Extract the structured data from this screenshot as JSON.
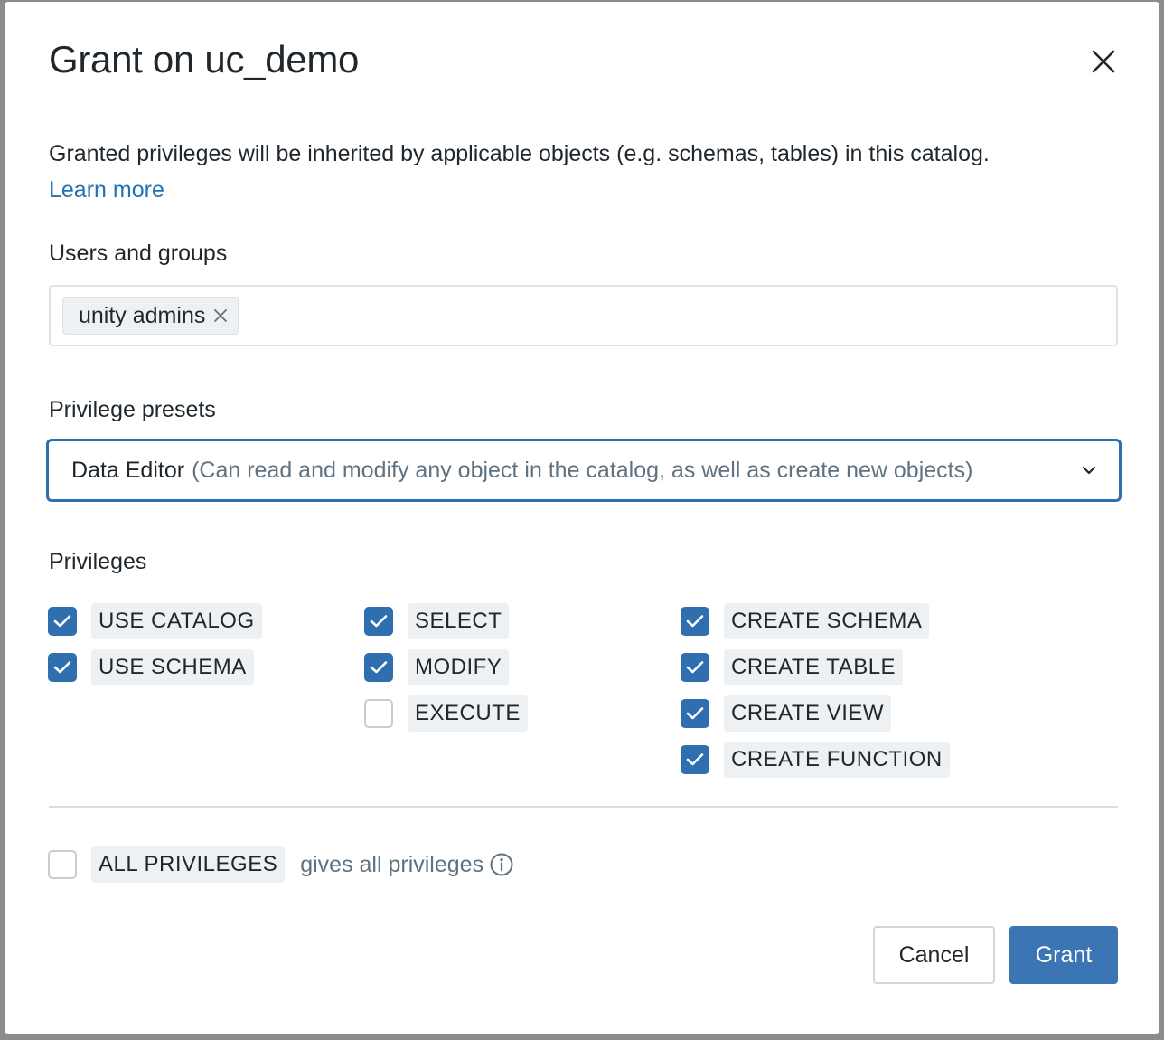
{
  "dialog": {
    "title": "Grant on uc_demo",
    "close_icon": "close-icon",
    "description": "Granted privileges will be inherited by applicable objects (e.g. schemas, tables) in this catalog.",
    "learn_more": "Learn more"
  },
  "users": {
    "label": "Users and groups",
    "tags": [
      {
        "label": "unity admins"
      }
    ]
  },
  "presets": {
    "label": "Privilege presets",
    "selected_name": "Data Editor",
    "selected_desc": "(Can read and modify any object in the catalog, as well as create new objects)"
  },
  "privileges": {
    "label": "Privileges",
    "items": [
      {
        "label": "USE CATALOG",
        "checked": true
      },
      {
        "label": "USE SCHEMA",
        "checked": true
      },
      {
        "label": "SELECT",
        "checked": true
      },
      {
        "label": "MODIFY",
        "checked": true
      },
      {
        "label": "EXECUTE",
        "checked": false
      },
      {
        "label": "CREATE SCHEMA",
        "checked": true
      },
      {
        "label": "CREATE TABLE",
        "checked": true
      },
      {
        "label": "CREATE VIEW",
        "checked": true
      },
      {
        "label": "CREATE FUNCTION",
        "checked": true
      }
    ]
  },
  "all_privileges": {
    "label": "ALL PRIVILEGES",
    "note": "gives all privileges",
    "checked": false
  },
  "buttons": {
    "cancel": "Cancel",
    "grant": "Grant"
  },
  "colors": {
    "accent": "#2f6fb0",
    "link": "#2272b4",
    "primary_button": "#3b75b4"
  }
}
